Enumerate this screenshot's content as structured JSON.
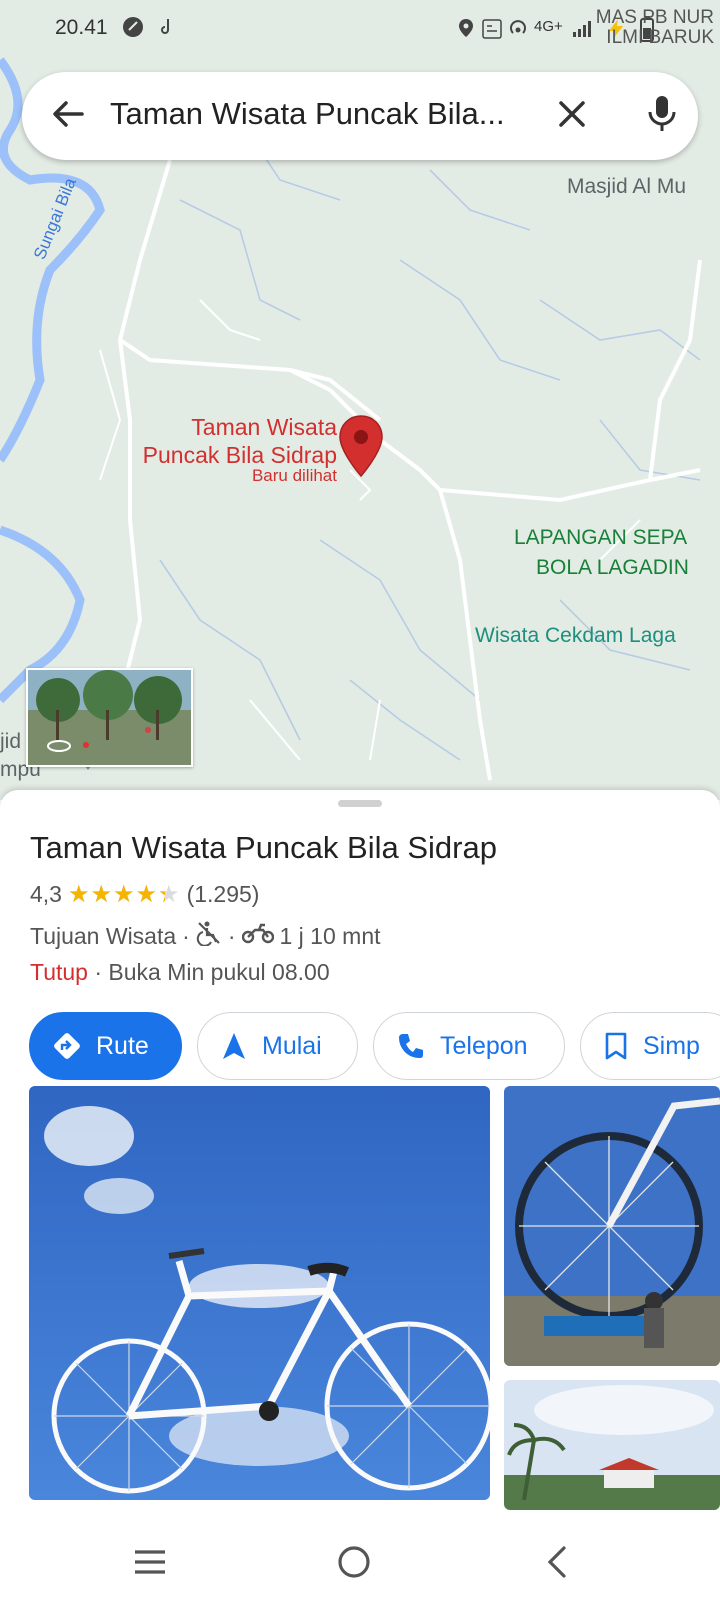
{
  "status_bar": {
    "time": "20.41",
    "network": "4G+",
    "right_text_line1": "MAS PB NUR",
    "right_text_line2": "ILMI BARUK"
  },
  "search": {
    "query": "Taman Wisata Puncak Bila..."
  },
  "map": {
    "labels": {
      "masjid": "Masjid Al Mu",
      "sungai": "Sungai Bila",
      "lapangan_1": "LAPANGAN SEPA",
      "lapangan_2": "BOLA LAGADIN",
      "cekdam": "Wisata Cekdam Laga",
      "edge_1": "jid",
      "edge_2": "mpu"
    },
    "pin": {
      "title_line1": "Taman Wisata",
      "title_line2": "Puncak Bila Sidrap",
      "subtitle": "Baru dilihat",
      "color": "#d32f2f"
    }
  },
  "place": {
    "name": "Taman Wisata Puncak Bila Sidrap",
    "rating": "4,3",
    "stars_value": 4.3,
    "stars_glyphs": "★★★★★",
    "review_count": "(1.295)",
    "category": "Tujuan Wisata",
    "separator": "·",
    "travel_time": "1 j 10 mnt",
    "status_closed": "Tutup",
    "opening_info": "· Buka Min pukul 08.00"
  },
  "actions": {
    "route": "Rute",
    "start": "Mulai",
    "call": "Telepon",
    "save": "Simp"
  },
  "colors": {
    "accent": "#1a73e8",
    "star": "#f4b400",
    "closed": "#d32f2f",
    "map_bg": "#e3ece4",
    "water": "#9cc0f9"
  }
}
